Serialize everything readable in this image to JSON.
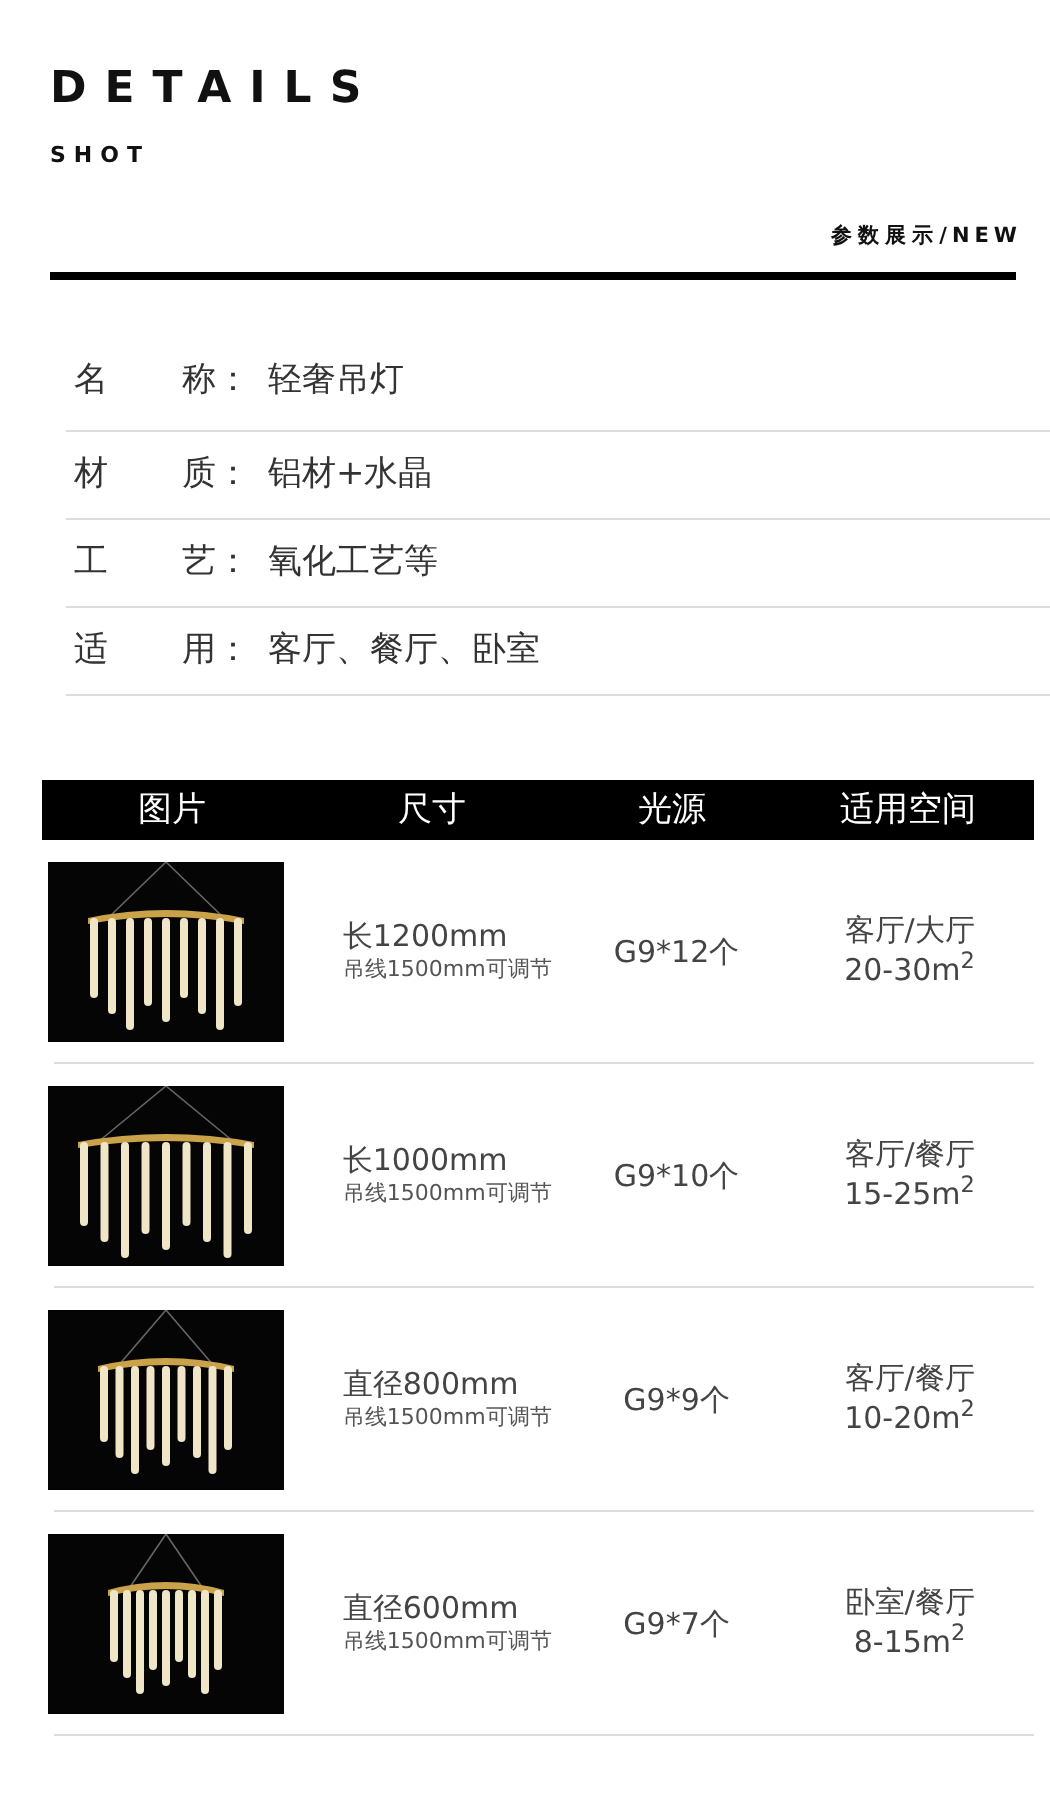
{
  "header": {
    "title": "DETAILS",
    "subtitle": "SHOT",
    "section_label": "参数展示/NEW"
  },
  "specs": [
    {
      "label": [
        "名",
        "称："
      ],
      "value": "轻奢吊灯"
    },
    {
      "label": [
        "材",
        "质："
      ],
      "value": "铝材+水晶"
    },
    {
      "label": [
        "工",
        "艺："
      ],
      "value": "氧化工艺等"
    },
    {
      "label": [
        "适",
        "用："
      ],
      "value": "客厅、餐厅、卧室"
    }
  ],
  "table": {
    "columns": [
      "图片",
      "尺寸",
      "光源",
      "适用空间"
    ],
    "rows": [
      {
        "size": "长1200mm",
        "cable": "吊线1500mm可调节",
        "light": "G9*12个",
        "room": "客厅/大厅",
        "area": "20-30m$^{2}$"
      },
      {
        "size": "长1000mm",
        "cable": "吊线1500mm可调节",
        "light": "G9*10个",
        "room": "客厅/餐厅",
        "area": "15-25m$^{2}$"
      },
      {
        "size": "直径800mm",
        "cable": "吊线1500mm可调节",
        "light": "G9*9个",
        "room": "客厅/餐厅",
        "area": "10-20m$^{2}$"
      },
      {
        "size": "直径600mm",
        "cable": "吊线1500mm可调节",
        "light": "G9*7个",
        "room": "卧室/餐厅",
        "area": "8-15m$^{2}$"
      }
    ]
  }
}
